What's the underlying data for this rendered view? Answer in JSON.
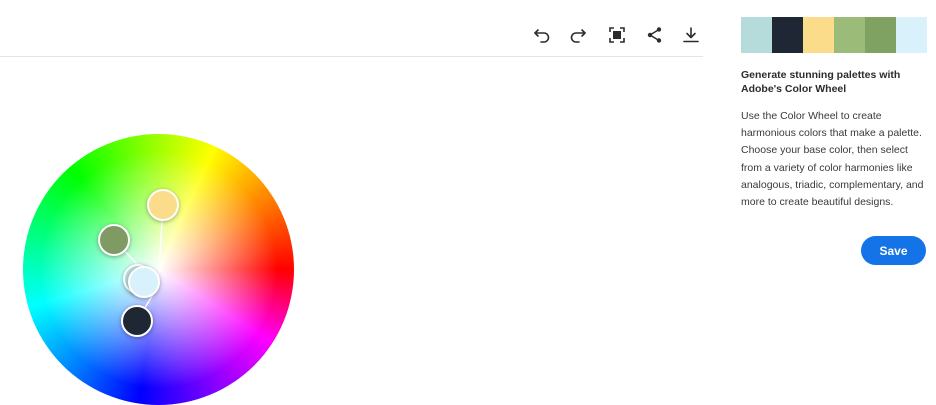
{
  "toolbar": {
    "buttons": [
      {
        "name": "undo-icon"
      },
      {
        "name": "redo-icon"
      },
      {
        "name": "fit-screen-icon"
      },
      {
        "name": "share-icon"
      },
      {
        "name": "download-icon"
      }
    ]
  },
  "palette": {
    "swatches": [
      "#b5dcdb",
      "#1e2733",
      "#fbdc8b",
      "#9bbb78",
      "#7fa262",
      "#d8f1fb"
    ]
  },
  "wheel": {
    "handles": [
      {
        "name": "handle-yellow",
        "color": "#fbdc8b"
      },
      {
        "name": "handle-green",
        "color": "#7f9a62"
      },
      {
        "name": "handle-teal",
        "color": "#b5dcdb"
      },
      {
        "name": "handle-light-blue",
        "color": "#d8f1fb"
      },
      {
        "name": "handle-navy",
        "color": "#1e2733"
      }
    ]
  },
  "info": {
    "title": "Generate stunning palettes with Adobe's Color Wheel",
    "body": "Use the Color Wheel to create harmonious colors that make a palette. Choose your base color, then select from a variety of color harmonies like analogous, triadic, complementary, and more to create beautiful designs."
  },
  "save_label": "Save",
  "colors": {
    "accent": "#1473e6"
  }
}
